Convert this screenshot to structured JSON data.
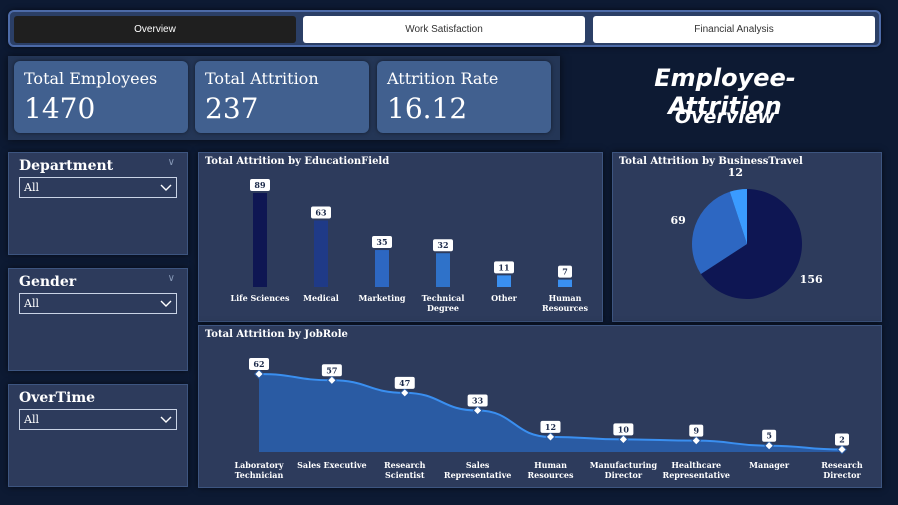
{
  "tabs": [
    {
      "label": "Overview",
      "active": true
    },
    {
      "label": "Work Satisfaction",
      "active": false
    },
    {
      "label": "Financial Analysis",
      "active": false
    }
  ],
  "kpis": [
    {
      "label": "Total Employees",
      "value": "1470"
    },
    {
      "label": "Total Attrition",
      "value": "237"
    },
    {
      "label": "Attrition Rate",
      "value": "16.12"
    }
  ],
  "header": {
    "title": "Employee-Attrition",
    "subtitle": "Overview"
  },
  "slicers": [
    {
      "title": "Department",
      "value": "All"
    },
    {
      "title": "Gender",
      "value": "All"
    },
    {
      "title": "OverTime",
      "value": "All"
    }
  ],
  "colors": {
    "dark_navy": "#0e1653",
    "navy": "#1f3a87",
    "blue": "#2f72c9",
    "light_blue": "#3a8ff0",
    "panel": "#2d3b5c"
  },
  "chart_data": [
    {
      "type": "bar",
      "title": "Total Attrition by EducationField",
      "categories": [
        "Life Sciences",
        "Medical",
        "Marketing",
        "Technical Degree",
        "Other",
        "Human Resources"
      ],
      "category_lines": [
        [
          "Life Sciences"
        ],
        [
          "Medical"
        ],
        [
          "Marketing"
        ],
        [
          "Technical",
          "Degree"
        ],
        [
          "Other"
        ],
        [
          "Human",
          "Resources"
        ]
      ],
      "values": [
        89,
        63,
        35,
        32,
        11,
        7
      ],
      "ylim": [
        0,
        89
      ]
    },
    {
      "type": "pie",
      "title": "Total Attrition by BusinessTravel",
      "values": [
        156,
        69,
        12
      ]
    },
    {
      "type": "area",
      "title": "Total Attrition by JobRole",
      "categories": [
        "Laboratory Technician",
        "Sales Executive",
        "Research Scientist",
        "Sales Representative",
        "Human Resources",
        "Manufacturing Director",
        "Healthcare Representative",
        "Manager",
        "Research Director"
      ],
      "category_lines": [
        [
          "Laboratory",
          "Technician"
        ],
        [
          "Sales Executive"
        ],
        [
          "Research",
          "Scientist"
        ],
        [
          "Sales",
          "Representative"
        ],
        [
          "Human",
          "Resources"
        ],
        [
          "Manufacturing",
          "Director"
        ],
        [
          "Healthcare",
          "Representative"
        ],
        [
          "Manager"
        ],
        [
          "Research",
          "Director"
        ]
      ],
      "values": [
        62,
        57,
        47,
        33,
        12,
        10,
        9,
        5,
        2
      ],
      "ylim": [
        0,
        62
      ]
    }
  ]
}
